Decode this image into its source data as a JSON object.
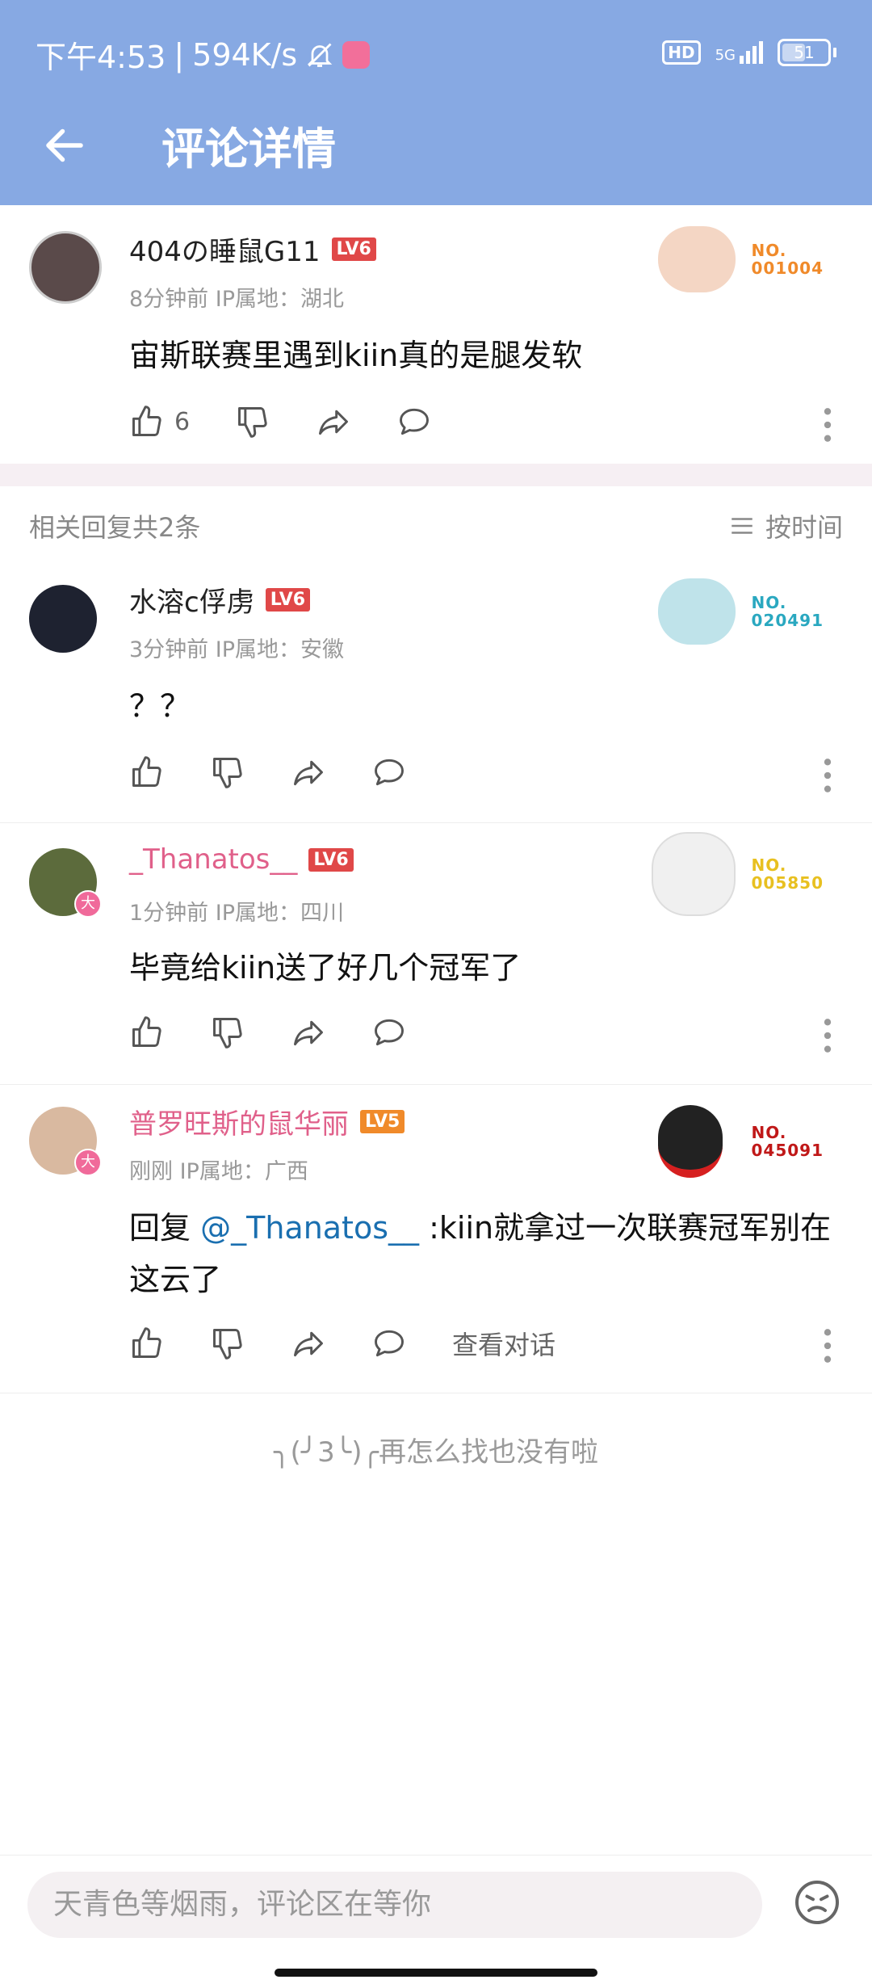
{
  "status_bar": {
    "time": "下午4:53",
    "speed": "594K/s",
    "hd": "HD",
    "network": "5G",
    "battery": "51"
  },
  "header": {
    "title": "评论详情"
  },
  "main_comment": {
    "username": "404の睡鼠G11",
    "level": "LV6",
    "meta": "8分钟前 IP属地：湖北",
    "text": "宙斯联赛里遇到kiin真的是腿发软",
    "likes": "6",
    "badge_no": "NO.",
    "badge_num": "001004"
  },
  "replies_header": {
    "label": "相关回复共2条",
    "sort": "按时间"
  },
  "replies": [
    {
      "username": "水溶c俘虏",
      "level": "LV6",
      "meta": "3分钟前 IP属地：安徽",
      "text": "？？",
      "badge_no": "NO.",
      "badge_num": "020491"
    },
    {
      "username": "_Thanatos__",
      "level": "LV6",
      "meta": "1分钟前 IP属地：四川",
      "text": "毕竟给kiin送了好几个冠军了",
      "badge_no": "NO.",
      "badge_num": "005850",
      "vip": "大"
    },
    {
      "username": "普罗旺斯的鼠华丽",
      "level": "LV5",
      "meta": "刚刚 IP属地：广西",
      "text_prefix": "回复",
      "mention": "@_Thanatos__",
      "text_rest": ":kiin就拿过一次联赛冠军别在这云了",
      "view_dialog": "查看对话",
      "badge_no": "NO.",
      "badge_num": "045091",
      "vip": "大"
    }
  ],
  "end_message": "╮(╯3╰)╭再怎么找也没有啦",
  "input": {
    "placeholder": "天青色等烟雨，评论区在等你"
  },
  "colors": {
    "header": "#87a9e3",
    "pink_name": "#e0608a",
    "lv6": "#e04848",
    "lv5": "#f08a2a",
    "mention": "#1a6fb0"
  }
}
